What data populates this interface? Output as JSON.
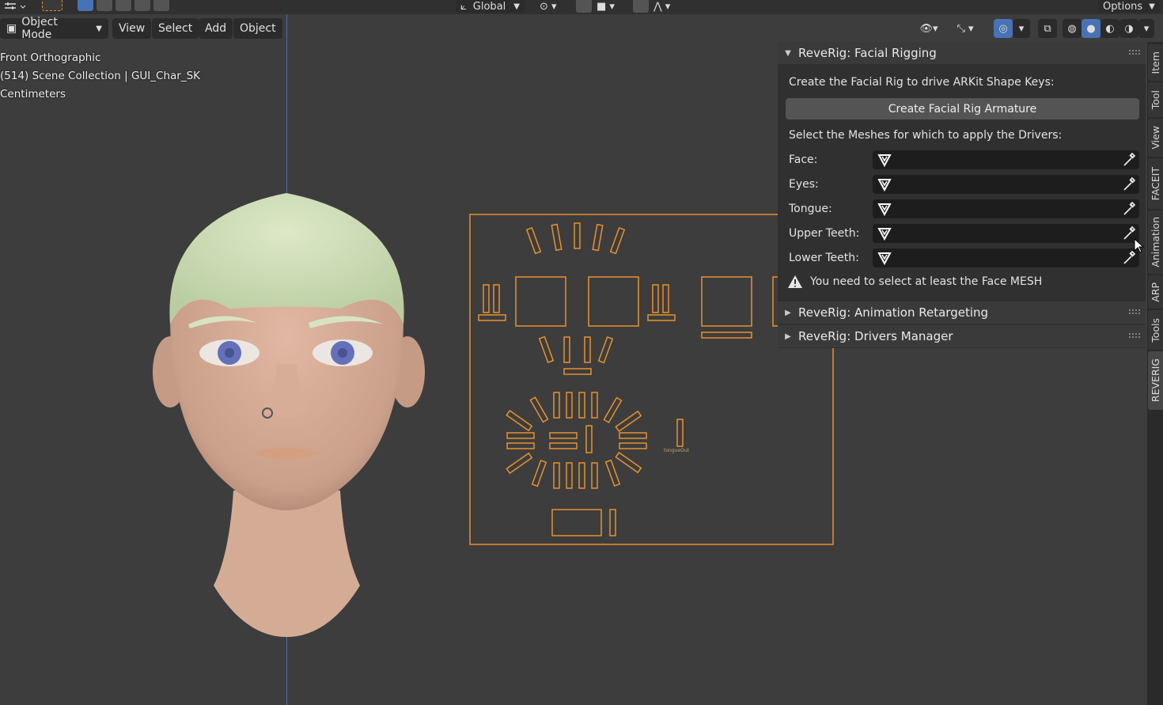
{
  "topbar": {
    "transform_orientation": "Global",
    "options_label": "Options"
  },
  "header": {
    "mode_label": "Object Mode",
    "menu": [
      "View",
      "Select",
      "Add",
      "Object"
    ]
  },
  "viewport_overlay": {
    "view_name": "Front Orthographic",
    "collection": "(514) Scene Collection | GUI_Char_SK",
    "units": "Centimeters"
  },
  "facial_panel": {
    "title": "ReveRig: Facial Rigging",
    "create_desc": "Create the Facial Rig to drive ARKit Shape Keys:",
    "create_button": "Create Facial Rig Armature",
    "select_desc": "Select the Meshes for which to apply the Drivers:",
    "fields": [
      {
        "label": "Face:",
        "value": ""
      },
      {
        "label": "Eyes:",
        "value": ""
      },
      {
        "label": "Tongue:",
        "value": ""
      },
      {
        "label": "Upper Teeth:",
        "value": ""
      },
      {
        "label": "Lower Teeth:",
        "value": ""
      }
    ],
    "warning": "You need to select at least the Face MESH"
  },
  "collapsed_panels": [
    {
      "title": "ReveRig: Animation Retargeting"
    },
    {
      "title": "ReveRig: Drivers Manager"
    }
  ],
  "side_tabs": [
    {
      "label": "Item",
      "active": false
    },
    {
      "label": "Tool",
      "active": false
    },
    {
      "label": "View",
      "active": false
    },
    {
      "label": "FACEIT",
      "active": false
    },
    {
      "label": "Animation",
      "active": false
    },
    {
      "label": "ARP",
      "active": false
    },
    {
      "label": "Tools",
      "active": false
    },
    {
      "label": "REVERIG",
      "active": true
    }
  ],
  "gui_label": "tongueOut",
  "colors": {
    "accent": "#4772b3",
    "rig_outline": "#e8922e",
    "panel_bg": "#303030",
    "viewport_bg": "#3d3d3d"
  }
}
